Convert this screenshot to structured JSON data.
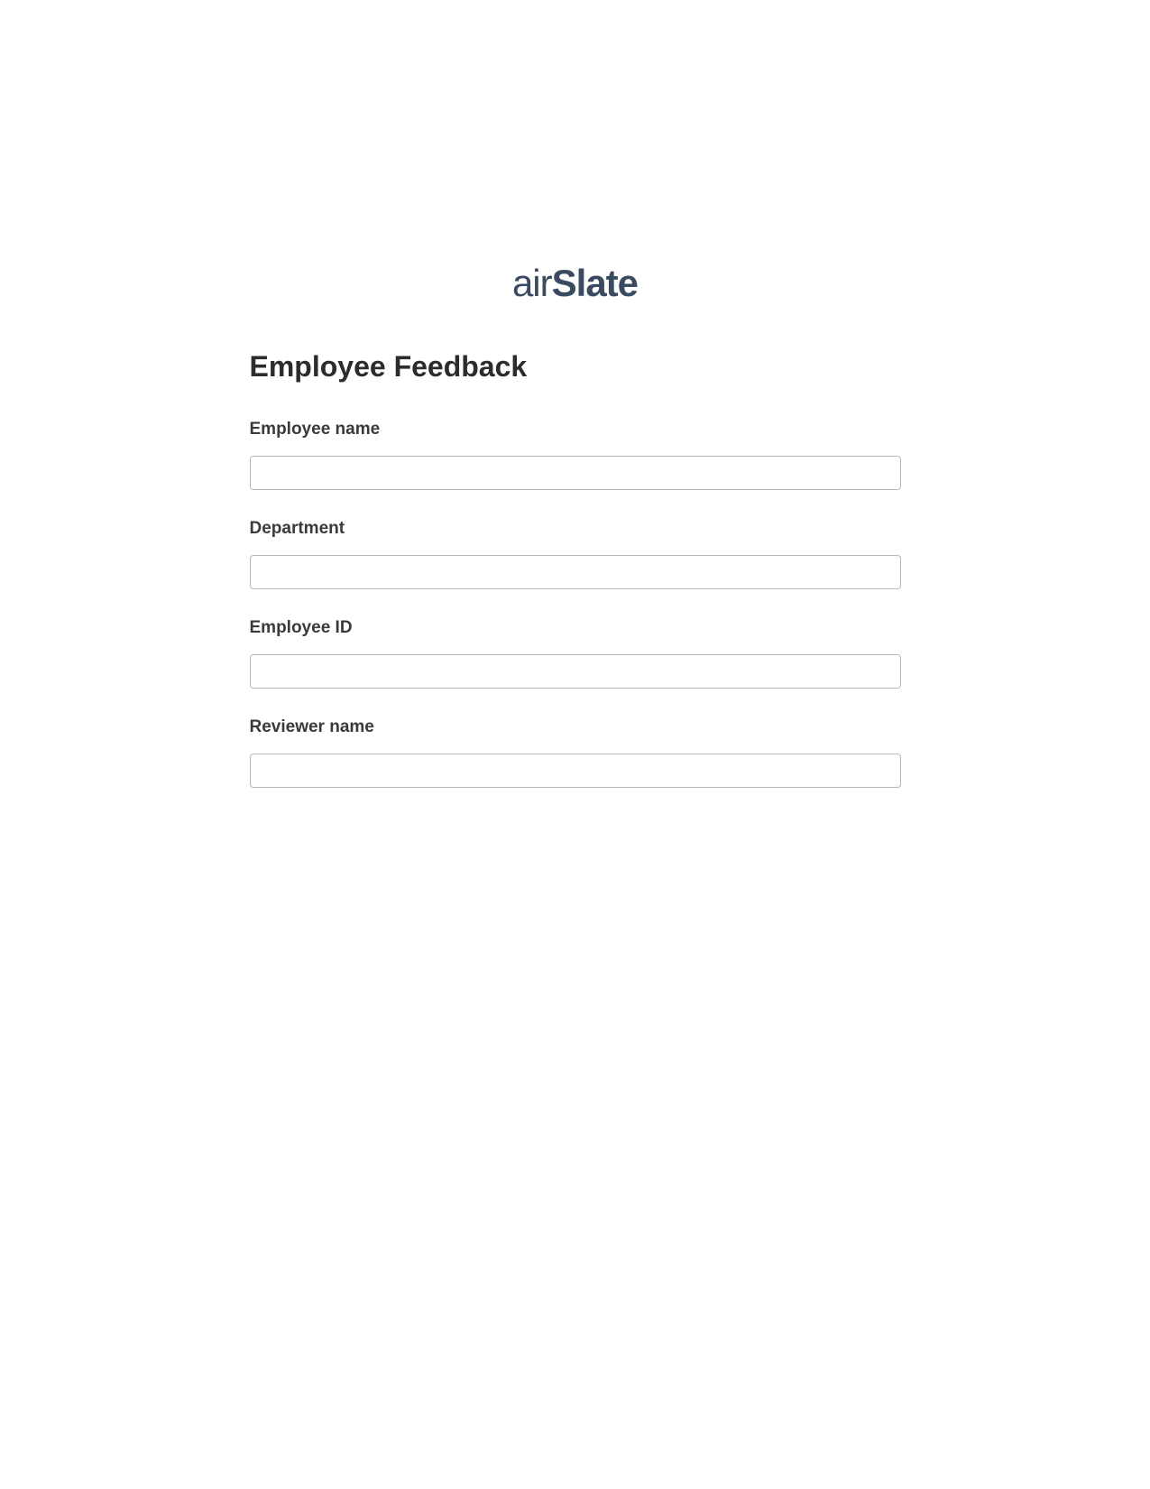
{
  "logo": {
    "prefix": "air",
    "suffix": "Slate"
  },
  "form": {
    "title": "Employee Feedback",
    "fields": [
      {
        "label": "Employee name",
        "value": ""
      },
      {
        "label": "Department",
        "value": ""
      },
      {
        "label": "Employee ID",
        "value": ""
      },
      {
        "label": "Reviewer name",
        "value": ""
      }
    ]
  }
}
